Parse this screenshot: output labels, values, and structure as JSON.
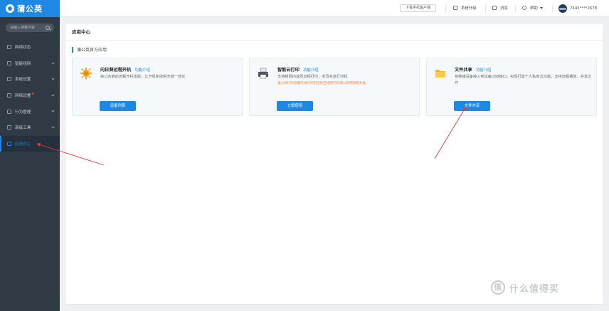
{
  "brand": {
    "name": "蒲公英"
  },
  "sidebar": {
    "search_placeholder": "请输入搜索内容",
    "items": [
      {
        "label": "网络状态",
        "icon": "network-status-icon",
        "has_children": false
      },
      {
        "label": "智能组网",
        "icon": "smart-network-icon",
        "has_children": true
      },
      {
        "label": "系统设置",
        "icon": "settings-icon",
        "has_children": true
      },
      {
        "label": "网络设置",
        "icon": "network-settings-icon",
        "has_children": true,
        "badge_dot": true
      },
      {
        "label": "行为管理",
        "icon": "behavior-icon",
        "has_children": true
      },
      {
        "label": "高级工具",
        "icon": "tools-icon",
        "has_children": true
      },
      {
        "label": "应用中心",
        "icon": "app-center-icon",
        "has_children": false,
        "active": true
      }
    ]
  },
  "topbar": {
    "download_label": "下载手机客户端",
    "upgrade_label": "系统升级",
    "messages_label": "消息",
    "help_label": "帮助",
    "account_label": "7445****2678"
  },
  "panel": {
    "title": "应用中心",
    "section_title": "蒲公英官方应用",
    "cards": [
      {
        "title": "向日葵远程开机",
        "link": "功能介绍",
        "desc": "串口内嵌的远程开机体验，让开机和控制无缝一体化",
        "note": "",
        "button": "设备列表",
        "icon": "sunflower-icon"
      },
      {
        "title": "智能云打印",
        "link": "功能介绍",
        "desc": "支持组网内成员远程打印，全员共享打印机",
        "note": "蒲公英打印机需先接打印机连接至组网内的蒲公英网络服务器",
        "button": "立即使用",
        "icon": "printer-icon"
      },
      {
        "title": "文件共享",
        "link": "功能介绍",
        "desc": "将移储设备接入到设备USB接口，实现打造个人私有云功能，支持远程播放、共享文件",
        "note": "",
        "button": "文件共享",
        "icon": "folder-icon"
      }
    ]
  },
  "watermark": {
    "text": "什么值得买",
    "icon_text": "值"
  },
  "colors": {
    "accent": "#1e88e5",
    "sidebar_bg": "#2f3a45",
    "annotation": "#e53935"
  }
}
